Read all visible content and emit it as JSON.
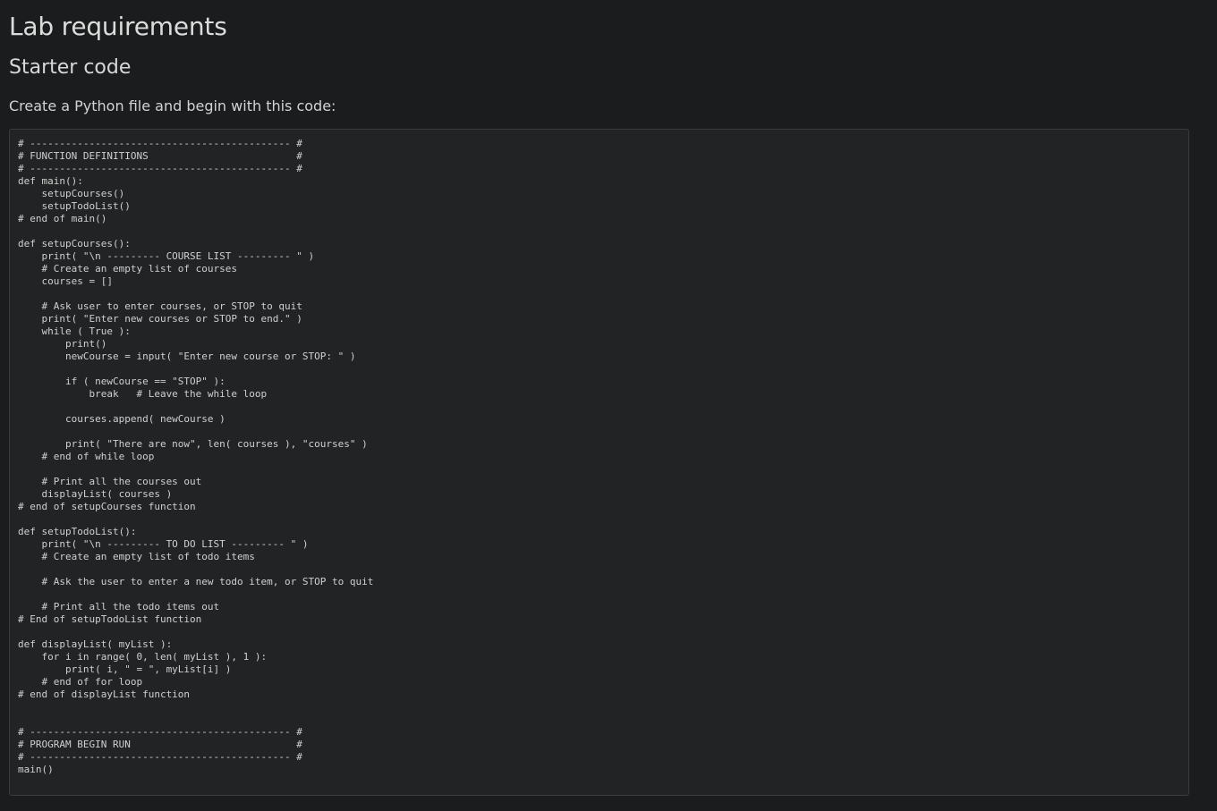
{
  "heading": {
    "title": "Lab requirements",
    "subtitle": "Starter code",
    "intro": "Create a Python file and begin with this code:"
  },
  "code": {
    "language": "python",
    "text": "# -------------------------------------------- #\n# FUNCTION DEFINITIONS                         #\n# -------------------------------------------- #\ndef main():\n    setupCourses()\n    setupTodoList()\n# end of main()\n\ndef setupCourses():\n    print( \"\\n --------- COURSE LIST --------- \" )\n    # Create an empty list of courses\n    courses = []\n\n    # Ask user to enter courses, or STOP to quit\n    print( \"Enter new courses or STOP to end.\" )\n    while ( True ):\n        print()\n        newCourse = input( \"Enter new course or STOP: \" )\n\n        if ( newCourse == \"STOP\" ):\n            break   # Leave the while loop\n\n        courses.append( newCourse )\n\n        print( \"There are now\", len( courses ), \"courses\" )\n    # end of while loop\n\n    # Print all the courses out\n    displayList( courses )\n# end of setupCourses function\n\ndef setupTodoList():\n    print( \"\\n --------- TO DO LIST --------- \" )\n    # Create an empty list of todo items\n\n    # Ask the user to enter a new todo item, or STOP to quit\n\n    # Print all the todo items out\n# End of setupTodoList function\n\ndef displayList( myList ):\n    for i in range( 0, len( myList ), 1 ):\n        print( i, \" = \", myList[i] )\n    # end of for loop\n# end of displayList function\n\n\n# -------------------------------------------- #\n# PROGRAM BEGIN RUN                            #\n# -------------------------------------------- #\nmain()"
  }
}
